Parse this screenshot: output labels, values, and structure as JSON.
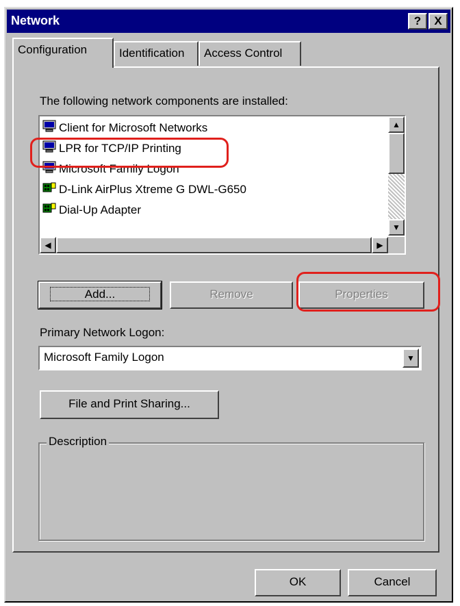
{
  "window": {
    "title": "Network",
    "help_btn": "?",
    "close_btn": "X"
  },
  "tabs": [
    {
      "label": "Configuration",
      "active": true
    },
    {
      "label": "Identification",
      "active": false
    },
    {
      "label": "Access Control",
      "active": false
    }
  ],
  "components": {
    "label": "The following network components are installed:",
    "items": [
      {
        "label": "Client for Microsoft Networks",
        "icon": "network-client-icon"
      },
      {
        "label": "LPR for TCP/IP Printing",
        "icon": "network-client-icon"
      },
      {
        "label": "Microsoft Family Logon",
        "icon": "network-client-icon"
      },
      {
        "label": "D-Link AirPlus Xtreme G DWL-G650",
        "icon": "network-adapter-icon"
      },
      {
        "label": "Dial-Up Adapter",
        "icon": "network-adapter-icon"
      }
    ]
  },
  "buttons": {
    "add": "Add...",
    "remove": "Remove",
    "properties": "Properties",
    "file_print": "File and Print Sharing...",
    "ok": "OK",
    "cancel": "Cancel"
  },
  "logon": {
    "label": "Primary Network Logon:",
    "value": "Microsoft Family Logon"
  },
  "description": {
    "title": "Description",
    "text": ""
  },
  "colors": {
    "titlebar": "#000080",
    "face": "#c0c0c0",
    "highlight": "#e0201c"
  }
}
